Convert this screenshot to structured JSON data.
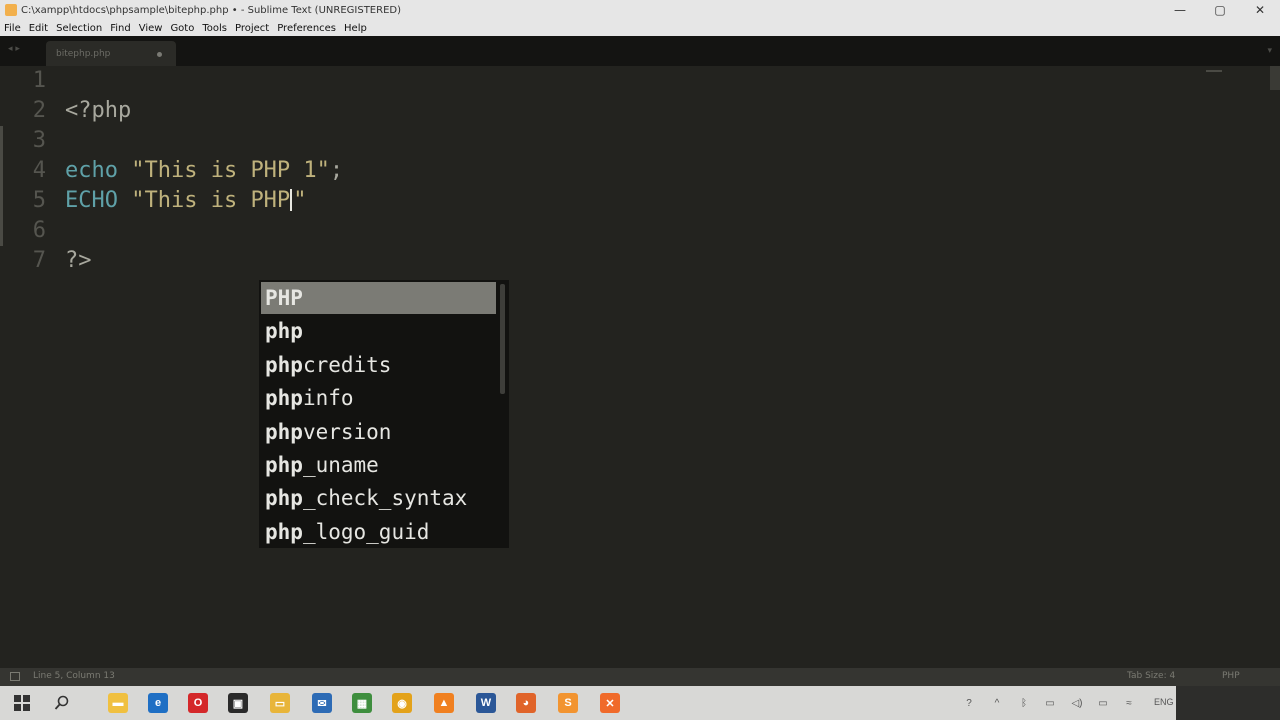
{
  "window": {
    "title": "C:\\xampp\\htdocs\\phpsample\\bitephp.php • - Sublime Text (UNREGISTERED)",
    "controls": [
      "—",
      "▢",
      "✕"
    ]
  },
  "menu": [
    "File",
    "Edit",
    "Selection",
    "Find",
    "View",
    "Goto",
    "Tools",
    "Project",
    "Preferences",
    "Help"
  ],
  "tabs": {
    "nav": "◂ ▸",
    "active": {
      "label": "bitephp.php",
      "modified": true
    },
    "dropdown": "▾"
  },
  "editor": {
    "lines": [
      {
        "num": "1",
        "parts": []
      },
      {
        "num": "2",
        "parts": [
          {
            "t": "<?php",
            "c": "plain"
          }
        ]
      },
      {
        "num": "3",
        "parts": []
      },
      {
        "num": "4",
        "parts": [
          {
            "t": "echo",
            "c": "kw"
          },
          {
            "t": " ",
            "c": "plain"
          },
          {
            "t": "\"This is PHP 1\"",
            "c": "str"
          },
          {
            "t": ";",
            "c": "plain"
          }
        ]
      },
      {
        "num": "5",
        "parts": [
          {
            "t": "ECHO",
            "c": "kw"
          },
          {
            "t": " ",
            "c": "plain"
          },
          {
            "t": "\"This is PHP",
            "c": "str"
          },
          {
            "t": "|",
            "c": "cursor"
          },
          {
            "t": "\"",
            "c": "str"
          }
        ]
      },
      {
        "num": "6",
        "parts": []
      },
      {
        "num": "7",
        "parts": [
          {
            "t": "?>",
            "c": "plain"
          }
        ]
      }
    ]
  },
  "autocomplete": {
    "options": [
      {
        "match": "PHP",
        "rest": "",
        "selected": true
      },
      {
        "match": "php",
        "rest": ""
      },
      {
        "match": "php",
        "rest": "credits"
      },
      {
        "match": "php",
        "rest": "info"
      },
      {
        "match": "php",
        "rest": "version"
      },
      {
        "match": "php",
        "rest": "_uname"
      },
      {
        "match": "php",
        "rest": "_check_syntax"
      },
      {
        "match": "php",
        "rest": "_logo_guid"
      }
    ]
  },
  "statusbar": {
    "position": "Line 5, Column 13",
    "tab_size": "Tab Size: 4",
    "syntax": "PHP"
  },
  "taskbar": {
    "apps": [
      {
        "name": "file-explorer",
        "color": "#f0c040",
        "glyph": "▬"
      },
      {
        "name": "edge",
        "color": "#1f6fc4",
        "glyph": "e"
      },
      {
        "name": "opera",
        "color": "#d4282a",
        "glyph": "O"
      },
      {
        "name": "store",
        "color": "#2a2a2a",
        "glyph": "▣"
      },
      {
        "name": "folder",
        "color": "#e8b53a",
        "glyph": "▭"
      },
      {
        "name": "mail",
        "color": "#2d6bb5",
        "glyph": "✉"
      },
      {
        "name": "sheets",
        "color": "#3e8e3e",
        "glyph": "▦"
      },
      {
        "name": "chrome",
        "color": "#e3a21a",
        "glyph": "◉"
      },
      {
        "name": "vlc",
        "color": "#f08020",
        "glyph": "▲"
      },
      {
        "name": "word",
        "color": "#2b5797",
        "glyph": "W"
      },
      {
        "name": "firefox",
        "color": "#e0642a",
        "glyph": "◕"
      },
      {
        "name": "sublime-text",
        "color": "#f29430",
        "glyph": "S"
      },
      {
        "name": "xampp",
        "color": "#f06a2a",
        "glyph": "✕"
      }
    ],
    "tray": {
      "icons": [
        "?",
        "^",
        "ᛒ",
        "▭",
        "◁)",
        "▭",
        "≈",
        "⌨"
      ],
      "language": "ENG"
    }
  },
  "colors": {
    "keyword": "#5fa1a8",
    "string": "#bfb27c",
    "plain": "#a8a89e",
    "background": "#23231f",
    "selection": "#7b7b75"
  }
}
